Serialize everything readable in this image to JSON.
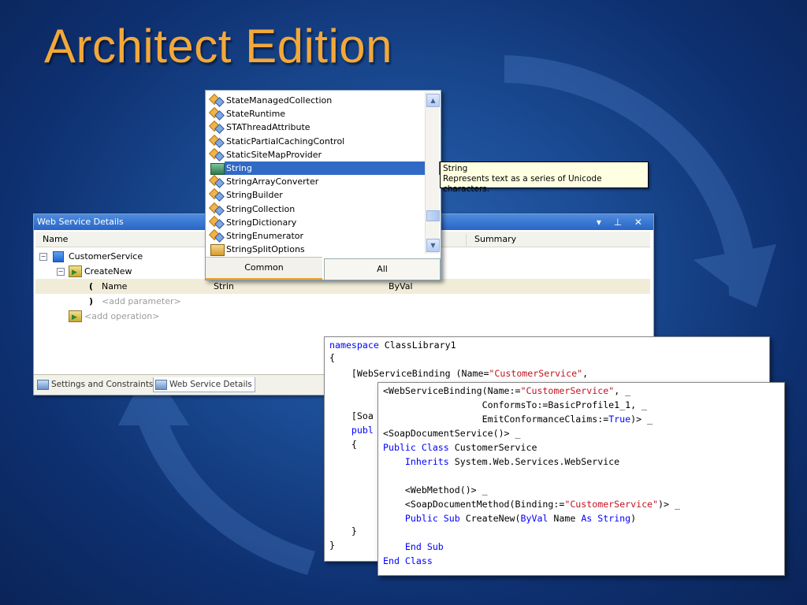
{
  "slide": {
    "title": "Architect Edition"
  },
  "dropdown": {
    "items": [
      {
        "label": "StateManagedCollection",
        "icon": "class-icon"
      },
      {
        "label": "StateRuntime",
        "icon": "class-icon"
      },
      {
        "label": "STAThreadAttribute",
        "icon": "class-icon"
      },
      {
        "label": "StaticPartialCachingControl",
        "icon": "class-icon"
      },
      {
        "label": "StaticSiteMapProvider",
        "icon": "class-icon"
      },
      {
        "label": "String",
        "icon": "struct-icon",
        "selected": true
      },
      {
        "label": "StringArrayConverter",
        "icon": "class-icon"
      },
      {
        "label": "StringBuilder",
        "icon": "class-icon"
      },
      {
        "label": "StringCollection",
        "icon": "class-icon"
      },
      {
        "label": "StringDictionary",
        "icon": "class-icon"
      },
      {
        "label": "StringEnumerator",
        "icon": "class-icon"
      },
      {
        "label": "StringSplitOptions",
        "icon": "enum-icon"
      }
    ],
    "tabs": {
      "common": "Common",
      "all": "All"
    }
  },
  "tooltip": {
    "title": "String",
    "description": "Represents text as a series of Unicode characters."
  },
  "wsd": {
    "title": "Web Service Details",
    "columns": {
      "name": "Name",
      "summary": "Summary"
    },
    "rows": {
      "service": "CustomerService",
      "operation": "CreateNew",
      "param_bracket": "(",
      "param_name": "Name",
      "param_type": "Strin",
      "param_modifier": "ByVal",
      "add_param_bracket": ")",
      "add_param": "<add parameter>",
      "add_op": "<add operation>"
    },
    "tabs": {
      "settings": "Settings and Constraints",
      "details": "Web Service Details"
    },
    "controls": "▾ ⊥ ✕"
  },
  "csharp": {
    "l1a": "namespace",
    "l1b": " ClassLibrary1",
    "l2": "{",
    "l3a": "    [WebServiceBinding (Name=",
    "l3b": "\"CustomerService\"",
    "l3c": ",",
    "l4": "    [Soa",
    "l5": "    publ",
    "l6": "    {",
    "l7": "    }",
    "l8": "}"
  },
  "vb": {
    "l1a": "<WebServiceBinding(Name:=",
    "l1b": "\"CustomerService\"",
    "l1c": ", _",
    "l2": "                  ConformsTo:=BasicProfile1_1, _",
    "l3a": "                  EmitConformanceClaims:=",
    "l3b": "True",
    "l3c": ")> _",
    "l4": "<SoapDocumentService()> _",
    "l5a": "Public Class",
    "l5b": " CustomerService",
    "l6a": "    Inherits",
    "l6b": " System.Web.Services.WebService",
    "l8": "    <WebMethod()> _",
    "l9a": "    <SoapDocumentMethod(Binding:=",
    "l9b": "\"CustomerService\"",
    "l9c": ")> _",
    "l10a": "    Public Sub",
    "l10b": " CreateNew(",
    "l10c": "ByVal",
    "l10d": " Name ",
    "l10e": "As String",
    "l10f": ")",
    "l12": "    End Sub",
    "l13": "End Class"
  }
}
